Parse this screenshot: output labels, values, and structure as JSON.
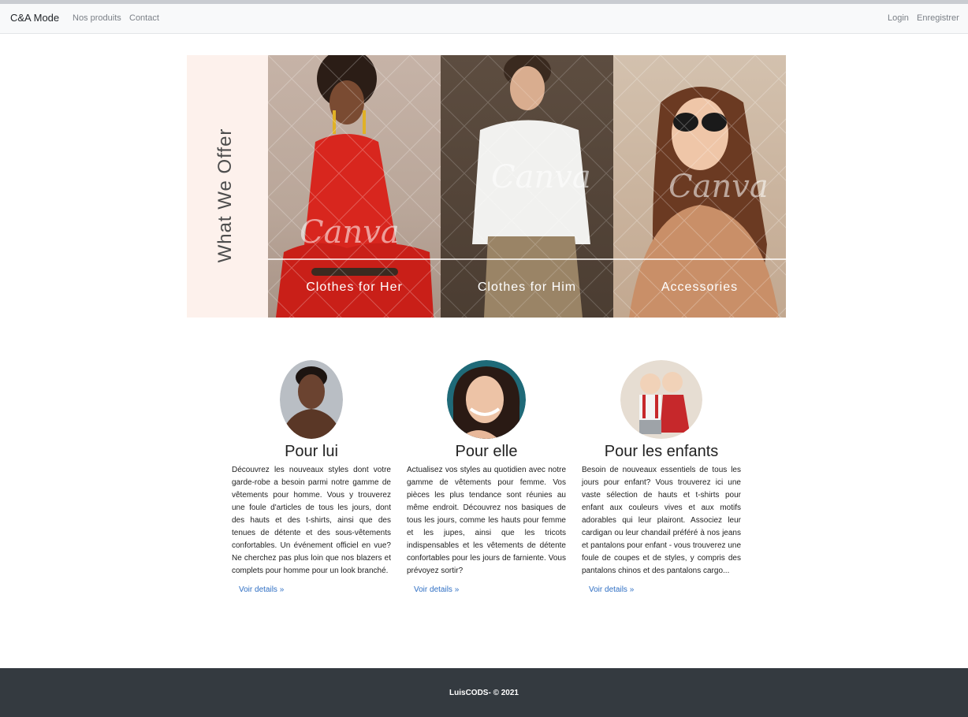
{
  "navbar": {
    "brand": "C&A Mode",
    "links": [
      "Nos produits",
      "Contact"
    ],
    "right_links": [
      "Login",
      "Enregistrer"
    ]
  },
  "banner": {
    "title": "What We Offer",
    "panels": [
      "Clothes for Her",
      "Clothes for Him",
      "Accessories"
    ],
    "watermark": "Canva"
  },
  "sections": [
    {
      "heading": "Pour lui",
      "text": "Découvrez les nouveaux styles dont votre garde-robe a besoin parmi notre gamme de vêtements pour homme. Vous y trouverez une foule d'articles de tous les jours, dont des hauts et des t-shirts, ainsi que des tenues de détente et des sous-vêtements confortables. Un événement officiel en vue? Ne cherchez pas plus loin que nos blazers et complets pour homme pour un look branché.",
      "link": "Voir details »"
    },
    {
      "heading": "Pour elle",
      "text": "Actualisez vos styles au quotidien avec notre gamme de vêtements pour femme. Vos pièces les plus tendance sont réunies au même endroit. Découvrez nos basiques de tous les jours, comme les hauts pour femme et les jupes, ainsi que les tricots indispensables et les vêtements de détente confortables pour les jours de farniente. Vous prévoyez sortir?",
      "link": "Voir details »"
    },
    {
      "heading": "Pour les enfants",
      "text": "Besoin de nouveaux essentiels de tous les jours pour enfant? Vous trouverez ici une vaste sélection de hauts et t-shirts pour enfant aux couleurs vives et aux motifs adorables qui leur plairont. Associez leur cardigan ou leur chandail préféré à nos jeans et pantalons pour enfant - vous trouverez une foule de coupes et de styles, y compris des pantalons chinos et des pantalons cargo...",
      "link": "Voir details »"
    }
  ],
  "footer": {
    "text": "LuisCODS- © 2021"
  },
  "colors": {
    "navbar_bg": "#f8f9fa",
    "link": "#2f6fc4",
    "footer_bg": "#343a40",
    "banner_side": "#fdf1ec"
  }
}
